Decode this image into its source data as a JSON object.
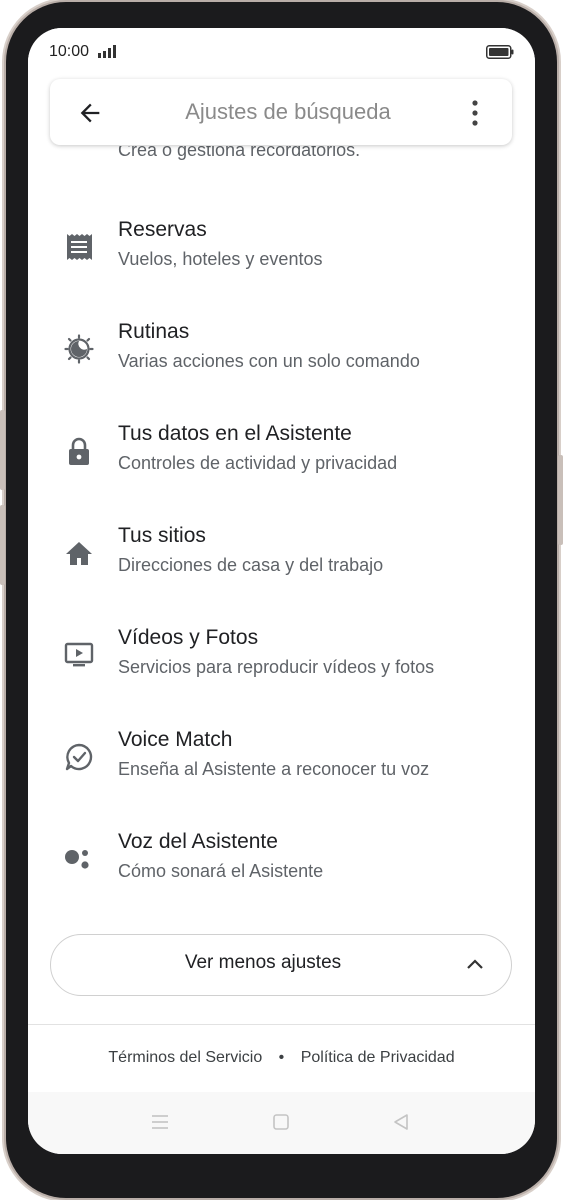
{
  "status_bar": {
    "time": "10:00"
  },
  "search": {
    "placeholder": "Ajustes de búsqueda"
  },
  "partial_item": {
    "subtitle": "Crea o gestiona recordatorios."
  },
  "items": [
    {
      "title": "Reservas",
      "subtitle": "Vuelos, hoteles y eventos",
      "icon": "receipt-icon"
    },
    {
      "title": "Rutinas",
      "subtitle": "Varias acciones con un solo comando",
      "icon": "routines-icon"
    },
    {
      "title": "Tus datos en el Asistente",
      "subtitle": "Controles de actividad y privacidad",
      "icon": "lock-icon"
    },
    {
      "title": "Tus sitios",
      "subtitle": "Direcciones de casa y del trabajo",
      "icon": "home-icon"
    },
    {
      "title": "Vídeos y Fotos",
      "subtitle": "Servicios para reproducir vídeos y fotos",
      "icon": "video-icon"
    },
    {
      "title": "Voice Match",
      "subtitle": "Enseña al Asistente a reconocer tu voz",
      "icon": "voice-match-icon"
    },
    {
      "title": "Voz del Asistente",
      "subtitle": "Cómo sonará el Asistente",
      "icon": "assistant-dots-icon"
    }
  ],
  "collapse_button": {
    "label": "Ver menos ajustes"
  },
  "footer": {
    "terms": "Términos del Servicio",
    "separator": "•",
    "privacy": "Política de Privacidad"
  },
  "colors": {
    "icon": "#5f6368",
    "title": "#202124",
    "subtitle": "#5f6368"
  }
}
